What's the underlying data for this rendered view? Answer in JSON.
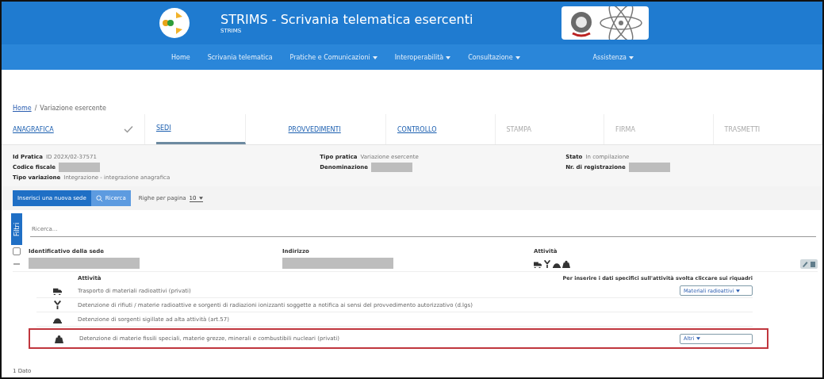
{
  "header": {
    "title": "STRIMS - Scrivania telematica esercenti",
    "subtitle": "STRIMS"
  },
  "nav": [
    {
      "label": "Home",
      "dropdown": false
    },
    {
      "label": "Scrivania telematica",
      "dropdown": false
    },
    {
      "label": "Pratiche e Comunicazioni",
      "dropdown": true
    },
    {
      "label": "Interoperabilità",
      "dropdown": true
    },
    {
      "label": "Consultazione",
      "dropdown": true
    },
    {
      "label": "Assistenza",
      "dropdown": true
    }
  ],
  "breadcrumb": {
    "separator": "/",
    "items": [
      "Home",
      "Variazione esercente"
    ]
  },
  "steps": [
    {
      "label": "ANAGRAFICA",
      "checked": true,
      "selected": false,
      "disabled": false
    },
    {
      "label": "SEDI",
      "checked": false,
      "selected": true,
      "disabled": false
    },
    {
      "label": "PROVVEDIMENTI",
      "checked": false,
      "selected": false,
      "disabled": false
    },
    {
      "label": "CONTROLLO",
      "checked": false,
      "selected": false,
      "disabled": false
    },
    {
      "label": "STAMPA",
      "checked": false,
      "selected": false,
      "disabled": true
    },
    {
      "label": "FIRMA",
      "checked": false,
      "selected": false,
      "disabled": true
    },
    {
      "label": "TRASMETTI",
      "checked": false,
      "selected": false,
      "disabled": true
    }
  ],
  "info_columns": [
    [
      {
        "label": "Id Pratica",
        "kind": "text",
        "value": "ID 202X/02-37571"
      },
      {
        "label": "Codice fiscale",
        "kind": "redacted"
      },
      {
        "label": "Tipo variazione",
        "kind": "text",
        "value": "Integrazione - integrazione anagrafica"
      }
    ],
    [
      {
        "label": "Tipo pratica",
        "kind": "text",
        "value": "Variazione esercente"
      },
      {
        "label": "Denominazione",
        "kind": "redacted"
      }
    ],
    [
      {
        "label": "Stato",
        "kind": "text",
        "value": "In compilazione"
      },
      {
        "label": "Nr. di registrazione",
        "kind": "redacted"
      }
    ]
  ],
  "toolbar": {
    "new_button": "Inserisci una nuova sede",
    "search_button": "Ricerca",
    "rows_label": "Righe per pagina",
    "rows_value": "10"
  },
  "filter_tab": "Filtri",
  "search": {
    "placeholder": "Ricerca..."
  },
  "table": {
    "select_all": {
      "checked": false
    },
    "columns": [
      "Identificativo della sede",
      "Indirizzo",
      "Attività"
    ],
    "rows": [
      {
        "expanded": true,
        "activity_icons": [
          {
            "kind": "truck"
          },
          {
            "kind": "trefoil"
          },
          {
            "kind": "dome"
          },
          {
            "kind": "weight"
          }
        ],
        "subtable": {
          "columns": [
            "Attività",
            "Per inserire i dati specifici sull'attività svolta cliccare sui riquadri"
          ],
          "rows": [
            {
              "kind": "truck",
              "text": "Trasporto di materiali radioattivi (privati)",
              "button": "Materiali radioattivi",
              "highlighted": false
            },
            {
              "kind": "trefoil",
              "text": "Detenzione di rifiuti / materie radioattive e sorgenti di radiazioni ionizzanti soggette a notifica ai sensi del provvedimento autorizzativo (d.lgs)",
              "highlighted": false
            },
            {
              "kind": "dome",
              "text": "Detenzione di sorgenti sigillate ad alta attività (art.57)",
              "highlighted": false
            },
            {
              "kind": "weight",
              "text": "Detenzione di materie fissili speciali, materie grezze, minerali e combustibili nucleari (privati)",
              "button": "Altri",
              "highlighted": true
            }
          ]
        }
      }
    ]
  },
  "footer": "1 Dato"
}
